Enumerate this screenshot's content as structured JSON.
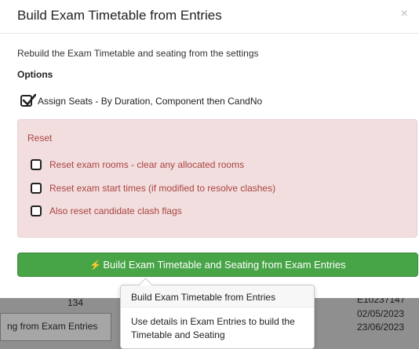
{
  "modal": {
    "title": "Build Exam Timetable from Entries",
    "close_label": "×",
    "description": "Rebuild the Exam Timetable and seating from the settings",
    "options_label": "Options",
    "assign_seats": {
      "label": "Assign Seats - By Duration, Component then CandNo",
      "checked": true
    },
    "reset": {
      "title": "Reset",
      "items": [
        {
          "label": "Reset exam rooms - clear any allocated rooms",
          "checked": false
        },
        {
          "label": "Reset exam start times (if modified to resolve clashes)",
          "checked": false
        },
        {
          "label": "Also reset candidate clash flags",
          "checked": false
        }
      ]
    },
    "build_button": {
      "icon": "bolt-icon",
      "label": "Build Exam Timetable and Seating from Exam Entries"
    }
  },
  "popover": {
    "title": "Build Exam Timetable from Entries",
    "body": "Use details in Exam Entries to build the Timetable and Seating"
  },
  "background": {
    "number": "134",
    "code": "E10237147",
    "date1": "02/05/2023",
    "date2": "23/06/2023",
    "button_fragment": "ng from Exam Entries"
  },
  "colors": {
    "success": "#47a447",
    "danger_bg": "#f2dede",
    "danger_text": "#a94442"
  }
}
